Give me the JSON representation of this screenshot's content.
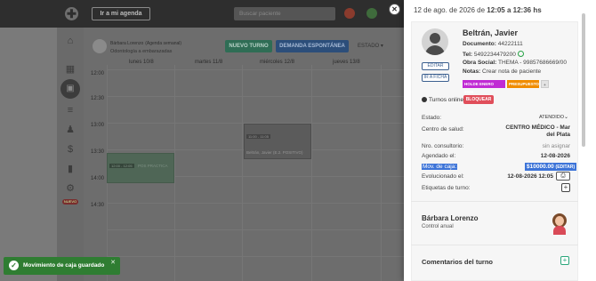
{
  "app": {
    "goto_agenda": "Ir a mi agenda",
    "search_placeholder": "Buscar paciente"
  },
  "agenda": {
    "professional_name": "Bárbara Lorenzo",
    "professional_note": "(Agenda semanal)",
    "professional_specialty": "Odontología a embarazadas",
    "new_appointments_button": "NUEVO TURNO",
    "spontaneous_demand_button": "DEMANDA ESPONTÁNEA",
    "status_filter": "ESTADO",
    "days": [
      "lunes 10/8",
      "martes 11/8",
      "miércoles 12/8",
      "jueves 13/8"
    ],
    "times": [
      "12:00",
      "12:30",
      "13:00",
      "13:30",
      "14:00",
      "14:30"
    ],
    "appointment_1": {
      "time": "12:00 - 12:05",
      "text": "POS PRACTICA"
    },
    "appointment_2": {
      "time": "11:00 - 11:05",
      "text": "Beltrán, Javier (E.2. POSITIVO)"
    },
    "sidebar_new_badge": "NUEVO"
  },
  "toast": {
    "message": "Movimiento de caja guardado"
  },
  "drawer": {
    "date": "12 de ago. de 2026",
    "time_range": "12:05 a 12:36 hs",
    "patient": {
      "name": "Beltrán, Javier",
      "document_label": "Documento:",
      "document": "44222111",
      "phone_label": "Tel:",
      "phone": "5492234479200",
      "insurance_label": "Obra Social:",
      "insurance": "THEMA - 99857686669/00",
      "notes_label": "Notas:",
      "notes": "Crear nota de paciente",
      "edit_button": "EDITAR",
      "record_button": "IR A FICHA",
      "tags": [
        "HOLDE ENERO 2026",
        "PRESUPUESTO",
        "+"
      ]
    },
    "online_label": "Turnos online",
    "block_button": "BLOQUEAR",
    "fields": {
      "status_label": "Estado:",
      "status_value": "ATENDIDO",
      "health_center_label": "Centro de salud:",
      "health_center_value": "CENTRO MÉDICO - Mar del Plata",
      "office_label": "Nro. consultorio:",
      "office_value": "sin asignar",
      "scheduled_label": "Agendado el:",
      "scheduled_value": "12-08-2026",
      "cash_label": "Mov. de caja:",
      "cash_value": "$10000.00",
      "cash_edit": "(EDITAR)",
      "evolved_label": "Evolucionado el:",
      "evolved_value": "12-08-2026 12:05",
      "tags_label": "Etiquetas de turno:"
    },
    "professional": {
      "name": "Bárbara Lorenzo",
      "subtitle": "Control anual"
    },
    "comments_title": "Comentarios del turno"
  },
  "colors": {
    "highlight": "#3d74d8",
    "tag_holde": "#c02bd4",
    "tag_presupuesto": "#f08c00",
    "block_button": "#e04e5a",
    "toast": "#2f7d32"
  }
}
